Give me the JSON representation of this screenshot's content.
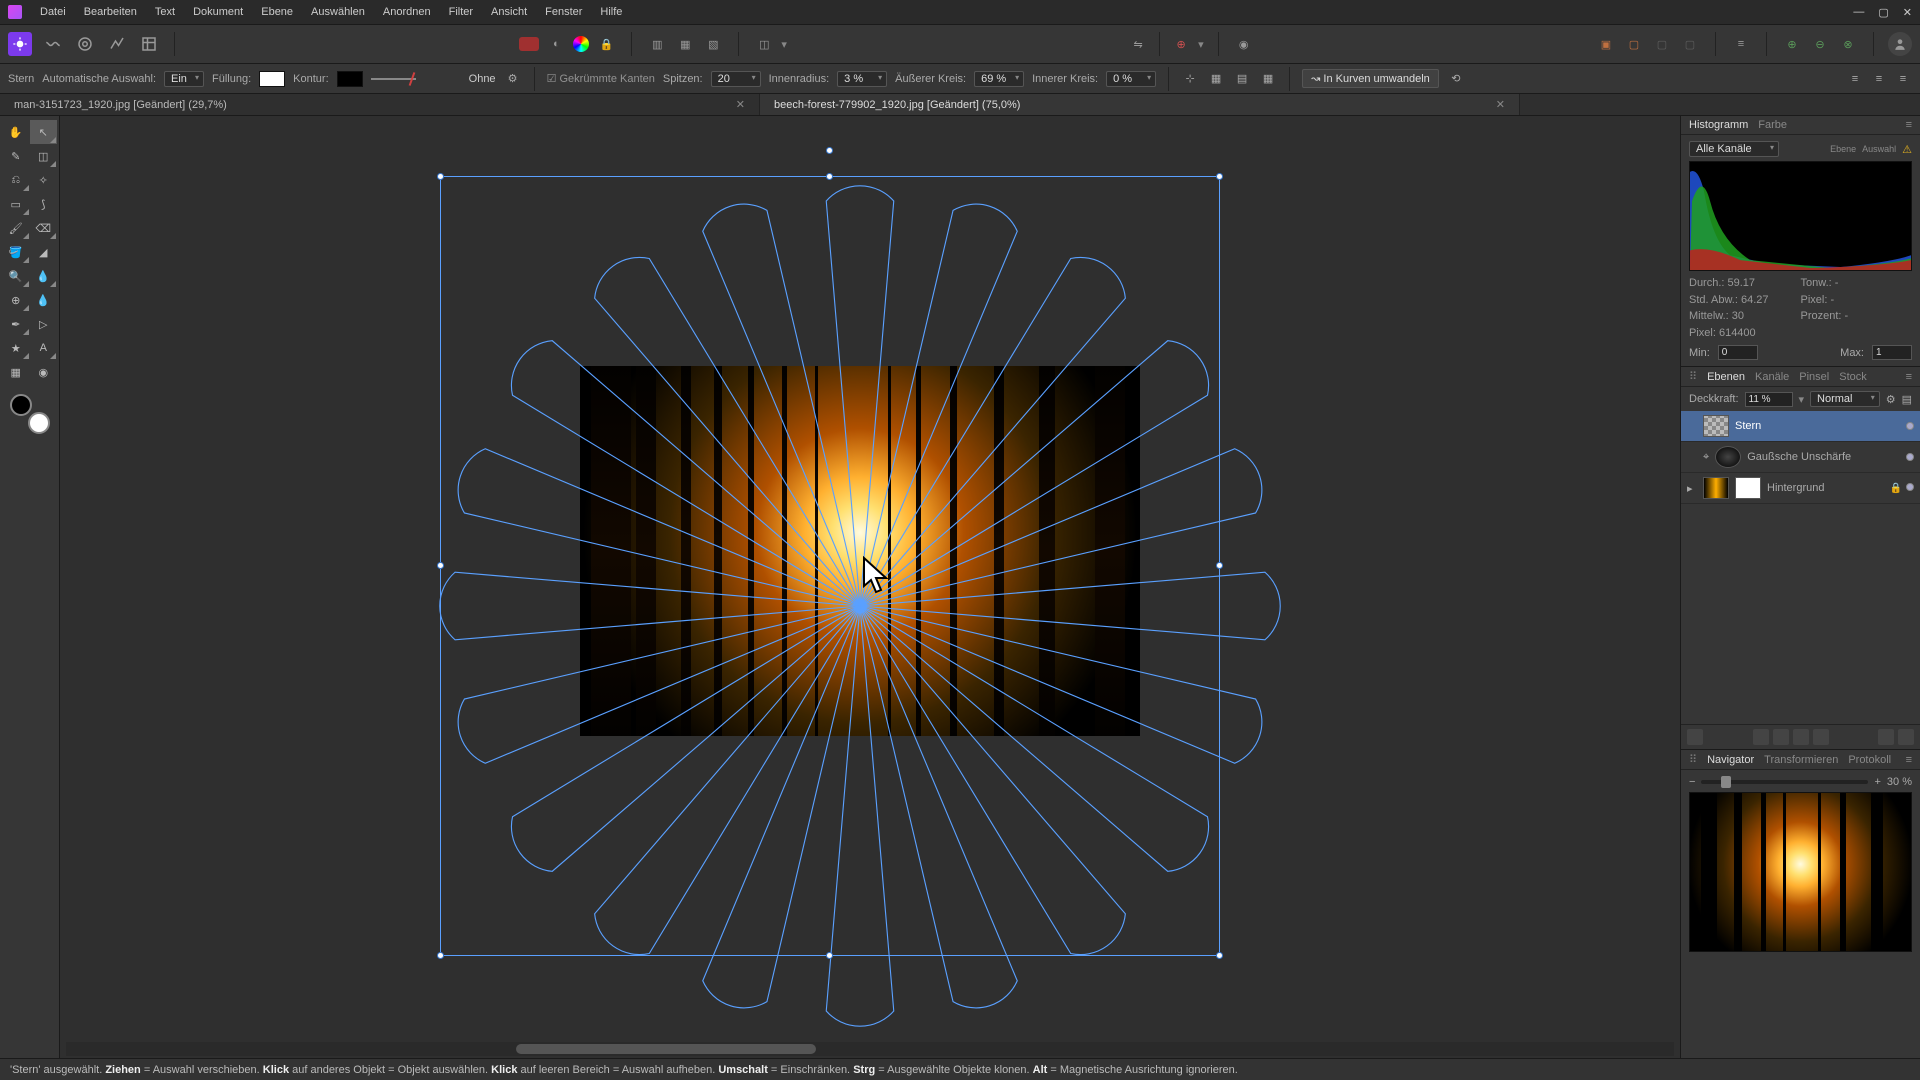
{
  "menu": [
    "Datei",
    "Bearbeiten",
    "Text",
    "Dokument",
    "Ebene",
    "Auswählen",
    "Anordnen",
    "Filter",
    "Ansicht",
    "Fenster",
    "Hilfe"
  ],
  "ctx": {
    "tool": "Stern",
    "auto_label": "Automatische Auswahl:",
    "auto_val": "Ein",
    "fill_label": "Füllung:",
    "stroke_label": "Kontur:",
    "stroke_style": "Ohne",
    "antialias": "Gekrümmte Kanten",
    "spitzen_label": "Spitzen:",
    "spitzen": "20",
    "innen_label": "Innenradius:",
    "innen": "3 %",
    "aussen_label": "Äußerer Kreis:",
    "aussen": "69 %",
    "innenk_label": "Innerer Kreis:",
    "innenk": "0 %",
    "convert": "In Kurven umwandeln"
  },
  "tabs": [
    {
      "title": "man-3151723_1920.jpg [Geändert] (29,7%)",
      "active": false
    },
    {
      "title": "beech-forest-779902_1920.jpg [Geändert] (75,0%)",
      "active": true
    }
  ],
  "hist": {
    "tabs": [
      "Histogramm",
      "Farbe"
    ],
    "channel": "Alle Kanäle",
    "mini": [
      "Ebene",
      "Auswahl"
    ],
    "stats": {
      "durch": "Durch.: 59.17",
      "std": "Std. Abw.: 64.27",
      "mittel": "Mittelw.: 30",
      "pixel": "Pixel: 614400",
      "tonw": "Tonw.: -",
      "pix": "Pixel: -",
      "proz": "Prozent: -"
    },
    "min_l": "Min:",
    "min": "0",
    "max_l": "Max:",
    "max": "1"
  },
  "layerspanel": {
    "tabs": [
      "Ebenen",
      "Kanäle",
      "Pinsel",
      "Stock"
    ],
    "opacity_l": "Deckkraft:",
    "opacity": "11 %",
    "blend": "Normal",
    "layers": [
      {
        "name": "Stern",
        "sel": true,
        "thumb": "pat",
        "mask": false
      },
      {
        "name": "Gaußsche Unschärfe",
        "sel": false,
        "thumb": "fx",
        "mask": false,
        "indent": true,
        "fxicon": true
      },
      {
        "name": "Hintergrund",
        "sel": false,
        "thumb": "img",
        "mask": true,
        "lock": true
      }
    ]
  },
  "nav": {
    "tabs": [
      "Navigator",
      "Transformieren",
      "Protokoll"
    ],
    "zoom": "30 %"
  },
  "status": {
    "text_parts": [
      "'Stern' ausgewählt. ",
      "Ziehen",
      " = Auswahl verschieben. ",
      "Klick",
      " auf anderes Objekt = Objekt auswählen. ",
      "Klick",
      " auf leeren Bereich = Auswahl aufheben. ",
      "Umschalt",
      " = Einschränken. ",
      "Strg",
      " = Ausgewählte Objekte klonen. ",
      "Alt",
      " = Magnetische Ausrichtung ignorieren."
    ]
  },
  "colors": {
    "fill": "#ffffff",
    "stroke": "#000000",
    "sel": "#5aa0ff"
  }
}
